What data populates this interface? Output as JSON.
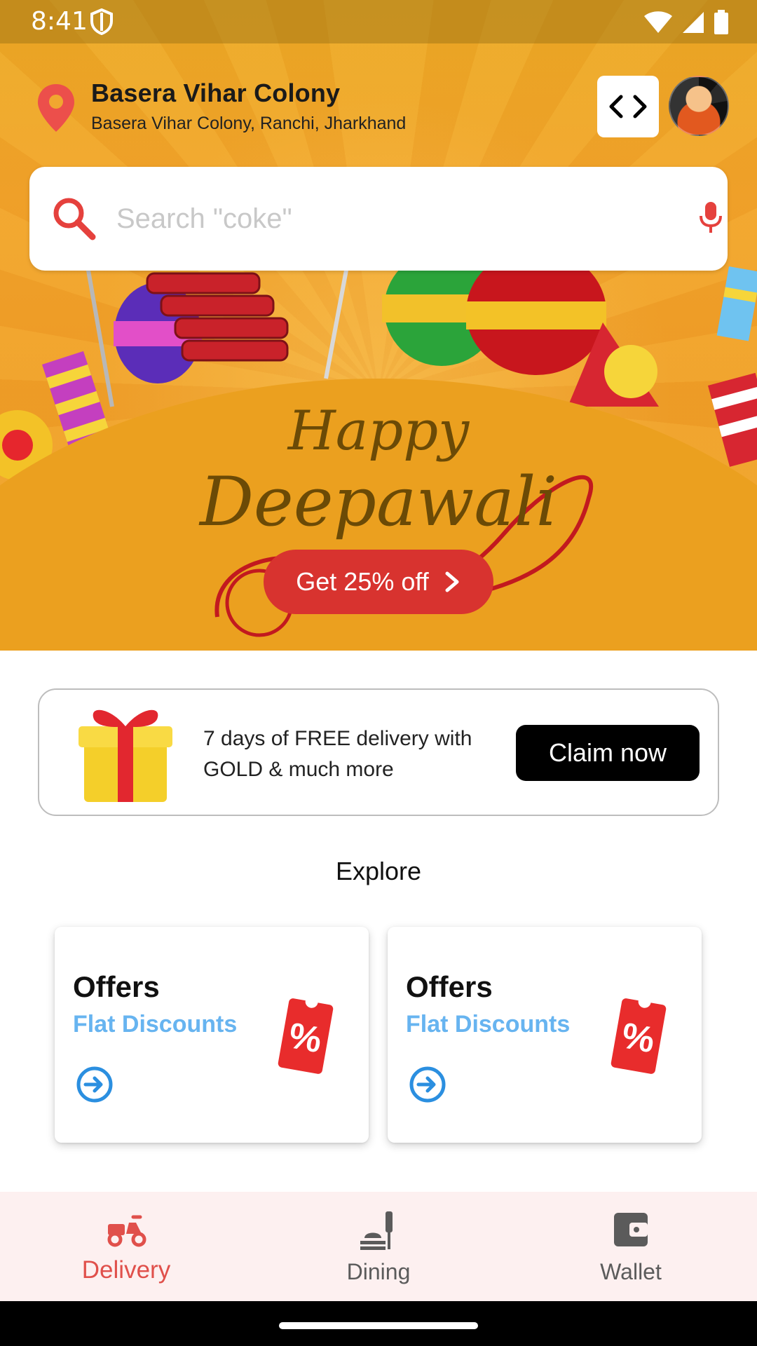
{
  "status_bar": {
    "time": "8:41"
  },
  "header": {
    "location_title": "Basera Vihar Colony",
    "location_subtitle": "Basera Vihar Colony, Ranchi, Jharkhand"
  },
  "search": {
    "placeholder": "Search \"coke\""
  },
  "banner": {
    "line1": "Happy",
    "line2": "Deepawali",
    "cta_label": "Get 25% off"
  },
  "gold_card": {
    "text": "7 days of FREE delivery with GOLD & much more",
    "button_label": "Claim now"
  },
  "explore": {
    "title": "Explore",
    "cards": [
      {
        "title": "Offers",
        "subtitle": "Flat Discounts"
      },
      {
        "title": "Offers",
        "subtitle": "Flat Discounts"
      }
    ]
  },
  "bottom_nav": {
    "items": [
      {
        "label": "Delivery",
        "icon": "scooter-icon",
        "active": true
      },
      {
        "label": "Dining",
        "icon": "dining-icon",
        "active": false
      },
      {
        "label": "Wallet",
        "icon": "wallet-icon",
        "active": false
      }
    ]
  },
  "colors": {
    "accent_red": "#d8332f",
    "nav_active": "#e0504b",
    "link_blue": "#67b4f0",
    "banner_orange": "#eda02a"
  }
}
